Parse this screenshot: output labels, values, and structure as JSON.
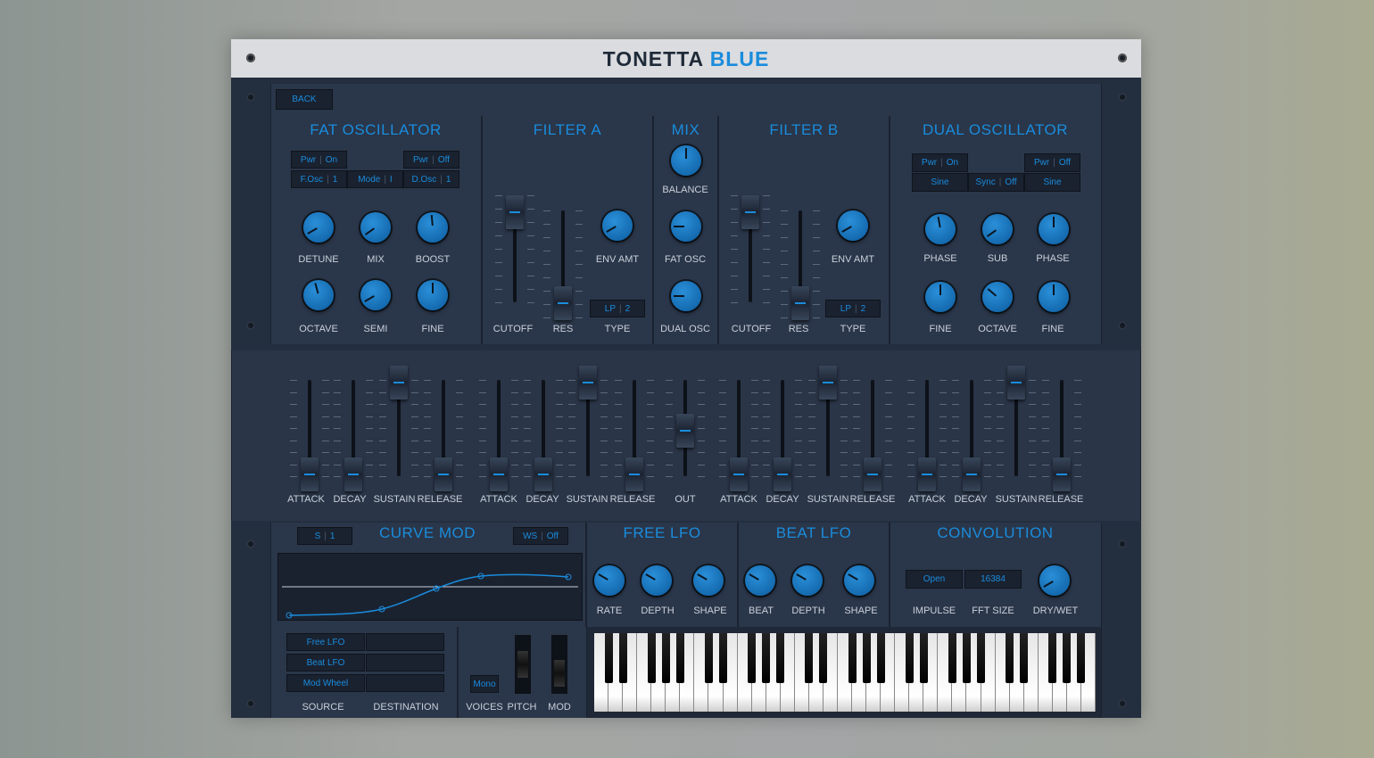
{
  "header": {
    "brand_part1": "TONETTA",
    "brand_part2": "BLUE"
  },
  "back_label": "BACK",
  "fat_osc": {
    "title": "FAT OSCILLATOR",
    "pwr1": "Pwr",
    "pwr1_val": "On",
    "pwr2": "Pwr",
    "pwr2_val": "Off",
    "fosc": "F.Osc",
    "fosc_val": "1",
    "mode": "Mode",
    "mode_val": "I",
    "dosc": "D.Osc",
    "dosc_val": "1",
    "knobs": [
      "DETUNE",
      "MIX",
      "BOOST",
      "OCTAVE",
      "SEMI",
      "FINE"
    ]
  },
  "filter_a": {
    "title": "FILTER A",
    "cutoff": "CUTOFF",
    "res": "RES",
    "env_amt": "ENV AMT",
    "type": "TYPE",
    "type_val1": "LP",
    "type_val2": "2"
  },
  "mix": {
    "title": "MIX",
    "balance": "BALANCE",
    "fat_osc": "FAT OSC",
    "dual_osc": "DUAL OSC"
  },
  "filter_b": {
    "title": "FILTER B",
    "cutoff": "CUTOFF",
    "res": "RES",
    "env_amt": "ENV AMT",
    "type": "TYPE",
    "type_val1": "LP",
    "type_val2": "2"
  },
  "dual_osc": {
    "title": "DUAL OSCILLATOR",
    "pwr1": "Pwr",
    "pwr1_val": "On",
    "pwr2": "Pwr",
    "pwr2_val": "Off",
    "wave1": "Sine",
    "sync": "Sync",
    "sync_val": "Off",
    "wave2": "Sine",
    "knobs": [
      "PHASE",
      "SUB",
      "PHASE",
      "FINE",
      "OCTAVE",
      "FINE"
    ]
  },
  "envelopes": {
    "env1": [
      "ATTACK",
      "DECAY",
      "SUSTAIN",
      "RELEASE"
    ],
    "env2": [
      "ATTACK",
      "DECAY",
      "SUSTAIN",
      "RELEASE"
    ],
    "out": "OUT",
    "env3": [
      "ATTACK",
      "DECAY",
      "SUSTAIN",
      "RELEASE"
    ],
    "env4": [
      "ATTACK",
      "DECAY",
      "SUSTAIN",
      "RELEASE"
    ]
  },
  "curve_mod": {
    "title": "CURVE MOD",
    "s_label": "S",
    "s_val": "1",
    "ws_label": "WS",
    "ws_val": "Off"
  },
  "free_lfo": {
    "title": "FREE LFO",
    "rate": "RATE",
    "depth": "DEPTH",
    "shape": "SHAPE"
  },
  "beat_lfo": {
    "title": "BEAT LFO",
    "beat": "BEAT",
    "depth": "DEPTH",
    "shape": "SHAPE"
  },
  "convolution": {
    "title": "CONVOLUTION",
    "impulse_val": "Open",
    "fft_val": "16384",
    "impulse": "IMPULSE",
    "fft_size": "FFT SIZE",
    "dry_wet": "DRY/WET"
  },
  "modmatrix": {
    "sources": [
      "Free LFO",
      "Beat LFO",
      "Mod Wheel"
    ],
    "source_label": "SOURCE",
    "destination_label": "DESTINATION"
  },
  "perf": {
    "voices_val": "Mono",
    "voices": "VOICES",
    "pitch": "PITCH",
    "mod": "MOD"
  },
  "colors": {
    "accent": "#1a8cdc",
    "panel": "#2a3649",
    "frame": "#232e3f"
  }
}
